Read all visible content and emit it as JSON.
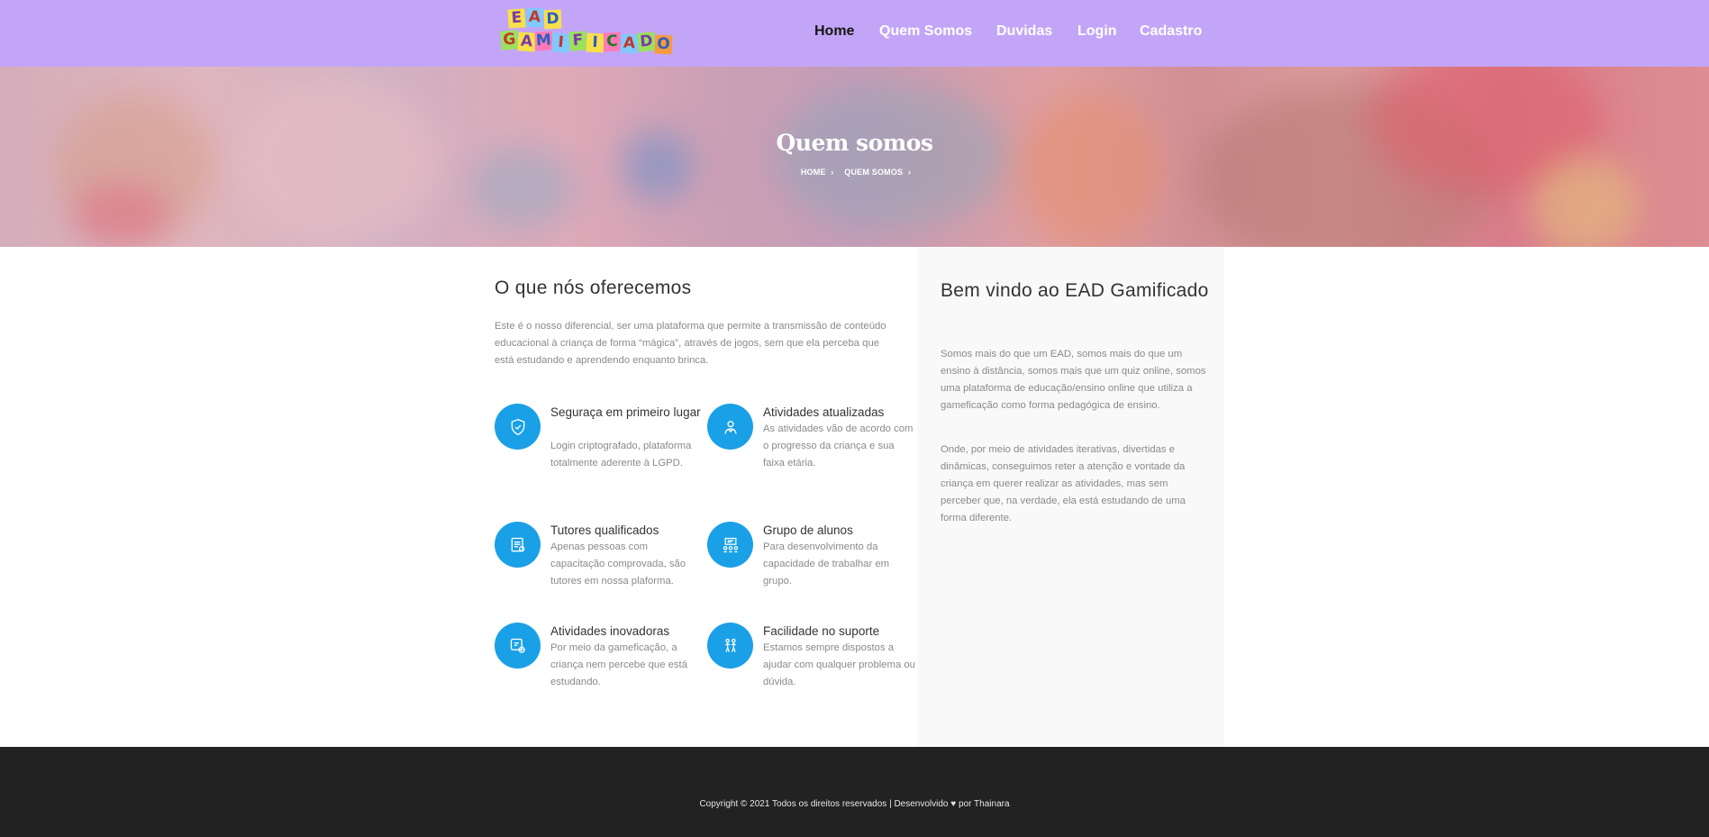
{
  "header": {
    "logo_text": "EAD GAMIFICADO",
    "nav": [
      "Home",
      "Quem Somos",
      "Duvidas",
      "Login",
      "Cadastro"
    ],
    "active": "Home"
  },
  "hero": {
    "title": "Quem somos",
    "breadcrumb": [
      "HOME",
      "QUEM SOMOS"
    ]
  },
  "offer": {
    "heading": "O que nós oferecemos",
    "intro": "Este é o nosso diferencial, ser uma plataforma que permite a transmissão de conteúdo educacional à criança de forma “mágica”, através de jogos, sem que ela perceba que está estudando e aprendendo enquanto brinca.",
    "features": [
      {
        "title": "Seguraça em primeiro lugar",
        "desc": "Login criptografado, plataforma totalmente aderente à LGPD.",
        "icon": "shield-icon"
      },
      {
        "title": "Atividades atualizadas",
        "desc": "As atividades vão de acordo com o progresso da criança e sua faixa etária.",
        "icon": "user-refresh-icon"
      },
      {
        "title": "Tutores qualificados",
        "desc": "Apenas pessoas com capacitação comprovada, são tutores em nossa plaforma.",
        "icon": "certificate-icon"
      },
      {
        "title": "Grupo de alunos",
        "desc": "Para desenvolvimento da capacidade de trabalhar em grupo.",
        "icon": "classroom-icon"
      },
      {
        "title": "Atividades inovadoras",
        "desc": "Por meio da gameficação, a criança nem percebe que está estudando.",
        "icon": "puzzle-icon"
      },
      {
        "title": "Facilidade no suporte",
        "desc": "Estamos sempre dispostos a ajudar com qualquer problema ou dúvida.",
        "icon": "support-icon"
      }
    ]
  },
  "welcome": {
    "heading": "Bem vindo ao EAD Gamificado",
    "p1": "Somos mais do que um EAD, somos mais do que um ensino à distância, somos mais que um quiz online, somos uma plataforma de educação/ensino online que utiliza a gameficação como forma pedagógica de ensino.",
    "p2": "Onde, por meio de atividades iterativas, divertidas e dinâmicas, conseguimos reter a atenção e vontade da criança em querer realizar as atividades, mas sem perceber que, na verdade, ela está estudando de uma forma diferente."
  },
  "footer": {
    "copyright_left": "Copyright © 2021 Todos os direitos reservados | Desenvolvido",
    "copyright_right": "por Thainara"
  },
  "colors": {
    "header_bg": "#c3a5f8",
    "accent": "#1aa0e6",
    "footer_bg": "#222222"
  }
}
